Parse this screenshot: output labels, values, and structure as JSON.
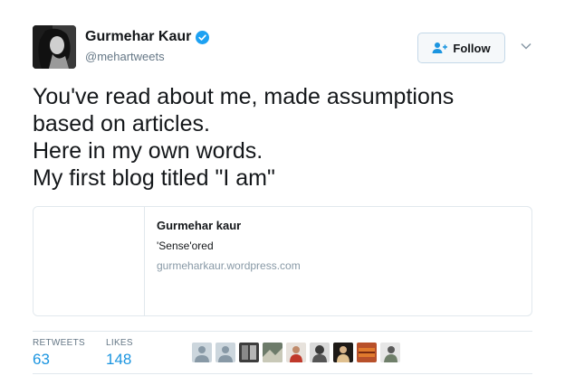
{
  "author": {
    "name": "Gurmehar Kaur",
    "handle": "@mehartweets",
    "verified": true
  },
  "follow_button": {
    "label": "Follow"
  },
  "tweet": {
    "lines": [
      "You've read about me, made assumptions",
      "based on articles.",
      "Here in my own words.",
      "My first blog titled \"I am\""
    ]
  },
  "card": {
    "title": "Gurmehar kaur",
    "description": "'Sense'ored",
    "domain": "gurmeharkaur.wordpress.com"
  },
  "stats": {
    "retweets_label": "RETWEETS",
    "retweets_count": "63",
    "likes_label": "LIKES",
    "likes_count": "148"
  },
  "colors": {
    "link_blue": "#1b95e0",
    "verified_blue": "#1da1f2",
    "muted_gray": "#657786"
  }
}
